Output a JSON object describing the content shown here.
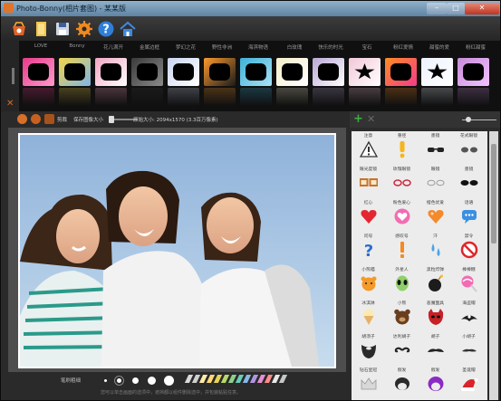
{
  "window": {
    "title": "Photo-Bonny(相片套图) - 某某版",
    "min": "–",
    "max": "□",
    "close": "✕"
  },
  "toolbar": {
    "icons": [
      "open-photo-icon",
      "folder-icon",
      "save-icon",
      "gear-icon",
      "help-icon",
      "home-icon"
    ]
  },
  "frames": {
    "categories": [
      "LOVE",
      "Bonny",
      "花儿满开",
      "金属边框",
      "梦幻之花",
      "野性非洲",
      "海滨物语",
      "白玫瑰",
      "快乐的时光",
      "宝石",
      "粉红爱情",
      "甜蜜的爱",
      "粉红甜蜜"
    ],
    "thumbs": [
      {
        "c1": "#e63a8a",
        "c2": "#ff9acb"
      },
      {
        "c1": "#f2d347",
        "c2": "#7fb6e8"
      },
      {
        "c1": "#f3a6c2",
        "c2": "#ffffff"
      },
      {
        "c1": "#3a3a3a",
        "c2": "#8a8a8a"
      },
      {
        "c1": "#c9d5f0",
        "c2": "#ffffff"
      },
      {
        "c1": "#ff9b2e",
        "c2": "#1a1a1a"
      },
      {
        "c1": "#3fb0d8",
        "c2": "#a7e2f5"
      },
      {
        "c1": "#f6efc9",
        "c2": "#ffffff"
      },
      {
        "c1": "#b9a7d6",
        "c2": "#ffffff"
      },
      {
        "c1": "#f2c7d8",
        "c2": "#ffffff"
      },
      {
        "c1": "#ff8c22",
        "c2": "#f23d8a"
      },
      {
        "c1": "#eef2ff",
        "c2": "#ffffff"
      },
      {
        "c1": "#c88bd8",
        "c2": "#f1c2ff"
      }
    ]
  },
  "info": {
    "rotate_left": "rotate-left-icon",
    "rotate_right": "rotate-right-icon",
    "crop": "剪裁",
    "keep_size": "保存图像大小",
    "original_size": "原始大小: 2094x1570 (3.3百万像素)"
  },
  "bottom": {
    "brush_label": "笔刷粗细",
    "tip": "您可以单击画面的选项中，遮挡都以组件删除选中，并包装粘贴任意。",
    "colors": [
      "#d9d9d9",
      "#cfcfcf",
      "#ffeaa8",
      "#ffd877",
      "#e6d257",
      "#b7d96b",
      "#8cd08c",
      "#66cdb8",
      "#87b8e6",
      "#b195e0",
      "#e38fd0",
      "#ff8b8b",
      "#e8e8e8",
      "#c7c7c7"
    ]
  },
  "stickers": [
    {
      "label": "注意",
      "icon": "warning-icon"
    },
    {
      "label": "重径",
      "icon": "exclamation-icon"
    },
    {
      "label": "墨镜",
      "icon": "sunglasses-icon"
    },
    {
      "label": "花式眼镜",
      "icon": "fancy-glasses-icon"
    },
    {
      "label": "眼光度镜",
      "icon": "square-glasses-icon"
    },
    {
      "label": "玫瑰眼镜",
      "icon": "pink-glasses-icon"
    },
    {
      "label": "眼镜",
      "icon": "round-glasses-icon"
    },
    {
      "label": "墨镜",
      "icon": "dark-glasses-icon"
    },
    {
      "label": "红心",
      "icon": "heart-icon"
    },
    {
      "label": "粉色爱心",
      "icon": "pink-heart-icon"
    },
    {
      "label": "橙色优爱",
      "icon": "orange-heart-icon"
    },
    {
      "label": "话语",
      "icon": "speech-bubble-icon"
    },
    {
      "label": "问号",
      "icon": "question-icon"
    },
    {
      "label": "感叹号",
      "icon": "exclaim-icon"
    },
    {
      "label": "汗",
      "icon": "sweat-icon"
    },
    {
      "label": "禁令",
      "icon": "prohibited-icon"
    },
    {
      "label": "小熊喵",
      "icon": "bear-icon"
    },
    {
      "label": "外星人",
      "icon": "alien-icon"
    },
    {
      "label": "黑粒炸弹",
      "icon": "bomb-icon"
    },
    {
      "label": "棒棒糖",
      "icon": "lollipop-icon"
    },
    {
      "label": "冰淇淋",
      "icon": "ice-cream-icon"
    },
    {
      "label": "小熊",
      "icon": "teddy-icon"
    },
    {
      "label": "恶魔面具",
      "icon": "devil-mask-icon"
    },
    {
      "label": "海盗帽",
      "icon": "pirate-hat-icon"
    },
    {
      "label": "胡须子",
      "icon": "beard-icon"
    },
    {
      "label": "达利胡子",
      "icon": "curly-mustache-icon"
    },
    {
      "label": "胡子",
      "icon": "mustache-icon"
    },
    {
      "label": "小胡子",
      "icon": "small-mustache-icon"
    },
    {
      "label": "钻石皇冠",
      "icon": "crown-icon"
    },
    {
      "label": "假发",
      "icon": "wig-icon"
    },
    {
      "label": "假发",
      "icon": "purple-wig-icon"
    },
    {
      "label": "圣诞帽",
      "icon": "santa-hat-icon"
    }
  ]
}
